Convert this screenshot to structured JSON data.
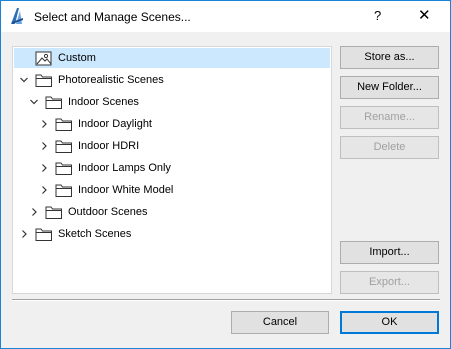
{
  "window": {
    "title": "Select and Manage Scenes...",
    "help_label": "?",
    "close_label": "✕"
  },
  "tree": [
    {
      "label": "Custom",
      "icon": "scene-image-icon",
      "expander": "none",
      "selected": true
    },
    {
      "label": "Photorealistic Scenes",
      "icon": "folder-icon",
      "expander": "expanded"
    },
    {
      "label": "Indoor Scenes",
      "icon": "folder-icon",
      "expander": "expanded"
    },
    {
      "label": "Indoor Daylight",
      "icon": "folder-icon",
      "expander": "collapsed"
    },
    {
      "label": "Indoor HDRI",
      "icon": "folder-icon",
      "expander": "collapsed"
    },
    {
      "label": "Indoor Lamps Only",
      "icon": "folder-icon",
      "expander": "collapsed"
    },
    {
      "label": "Indoor White Model",
      "icon": "folder-icon",
      "expander": "collapsed"
    },
    {
      "label": "Outdoor Scenes",
      "icon": "folder-icon",
      "expander": "collapsed"
    },
    {
      "label": "Sketch Scenes",
      "icon": "folder-icon",
      "expander": "collapsed"
    }
  ],
  "buttons": {
    "store_as": "Store as...",
    "new_folder": "New Folder...",
    "rename": "Rename...",
    "delete": "Delete",
    "import": "Import...",
    "export": "Export...",
    "cancel": "Cancel",
    "ok": "OK"
  },
  "colors": {
    "accent": "#0078d7",
    "selection": "#cce8ff",
    "window_border": "#1883d7"
  }
}
